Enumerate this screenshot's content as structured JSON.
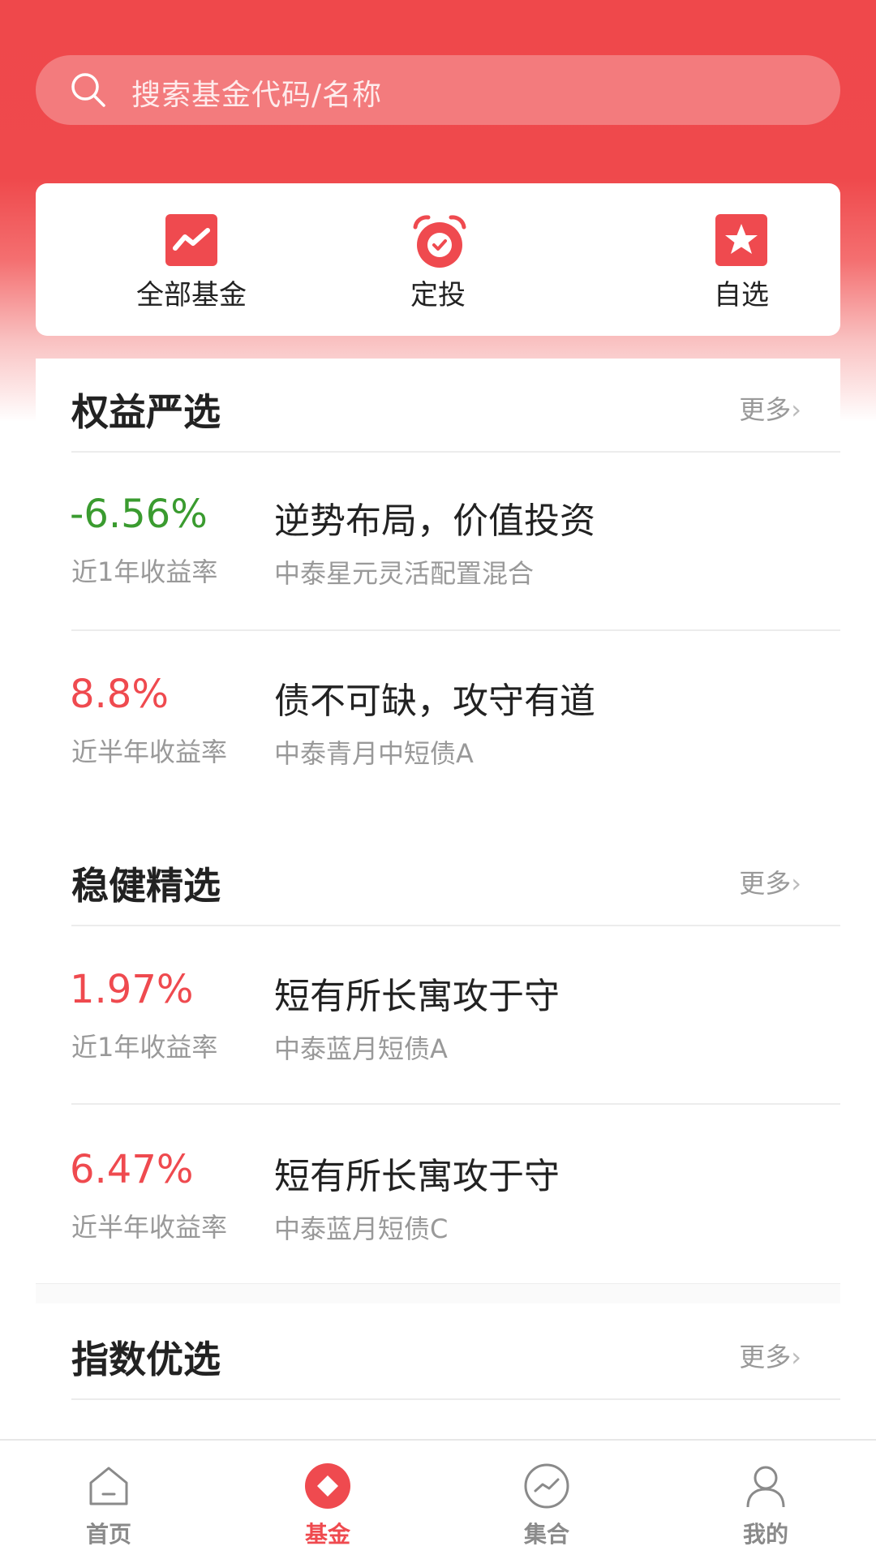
{
  "search": {
    "placeholder": "搜索基金代码/名称"
  },
  "quick_actions": [
    {
      "label": "全部基金",
      "icon": "chart-icon"
    },
    {
      "label": "定投",
      "icon": "alarm-clock-icon"
    },
    {
      "label": "自选",
      "icon": "star-icon"
    }
  ],
  "sections": [
    {
      "title": "权益严选",
      "more": "更多",
      "funds": [
        {
          "rate": "-6.56%",
          "period": "近1年收益率",
          "slogan": "逆势布局，价值投资",
          "name": "中泰星元灵活配置混合"
        },
        {
          "rate": "8.8%",
          "period": "近半年收益率",
          "slogan": "债不可缺，攻守有道",
          "name": "中泰青月中短债A"
        }
      ]
    },
    {
      "title": "稳健精选",
      "more": "更多",
      "funds": [
        {
          "rate": "1.97%",
          "period": "近1年收益率",
          "slogan": "短有所长寓攻于守",
          "name": "中泰蓝月短债A"
        },
        {
          "rate": "6.47%",
          "period": "近半年收益率",
          "slogan": "短有所长寓攻于守",
          "name": "中泰蓝月短债C"
        }
      ]
    },
    {
      "title": "指数优选",
      "more": "更多",
      "funds": []
    }
  ],
  "colors": {
    "brand": "#ef484b",
    "positive": "#ef4a4f",
    "negative": "#3a9b2f"
  },
  "tabs": [
    {
      "label": "首页",
      "icon": "home-icon",
      "active": false
    },
    {
      "label": "基金",
      "icon": "diamond-icon",
      "active": true
    },
    {
      "label": "集合",
      "icon": "trend-circle-icon",
      "active": false
    },
    {
      "label": "我的",
      "icon": "user-icon",
      "active": false
    }
  ]
}
